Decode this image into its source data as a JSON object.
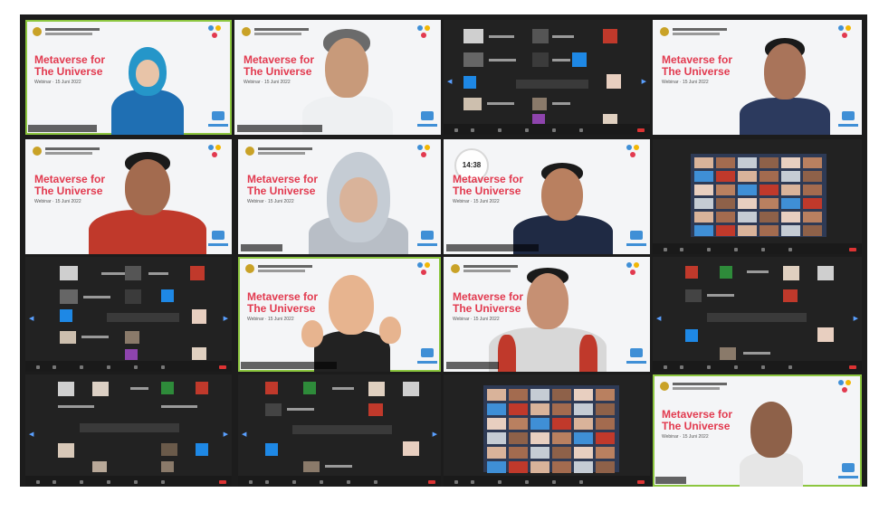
{
  "slide": {
    "title_line1": "Metaverse for",
    "title_line2": "The Universe",
    "date": "Webinar · 15 Juni 2022"
  },
  "clock": {
    "time": "14:38"
  },
  "colors": {
    "slide_title": "#e23a4f",
    "active_border": "#8cc63f",
    "grid_background": "#1c1c1c",
    "brand_blue": "#3f8fd6",
    "leave_red": "#d33333"
  }
}
